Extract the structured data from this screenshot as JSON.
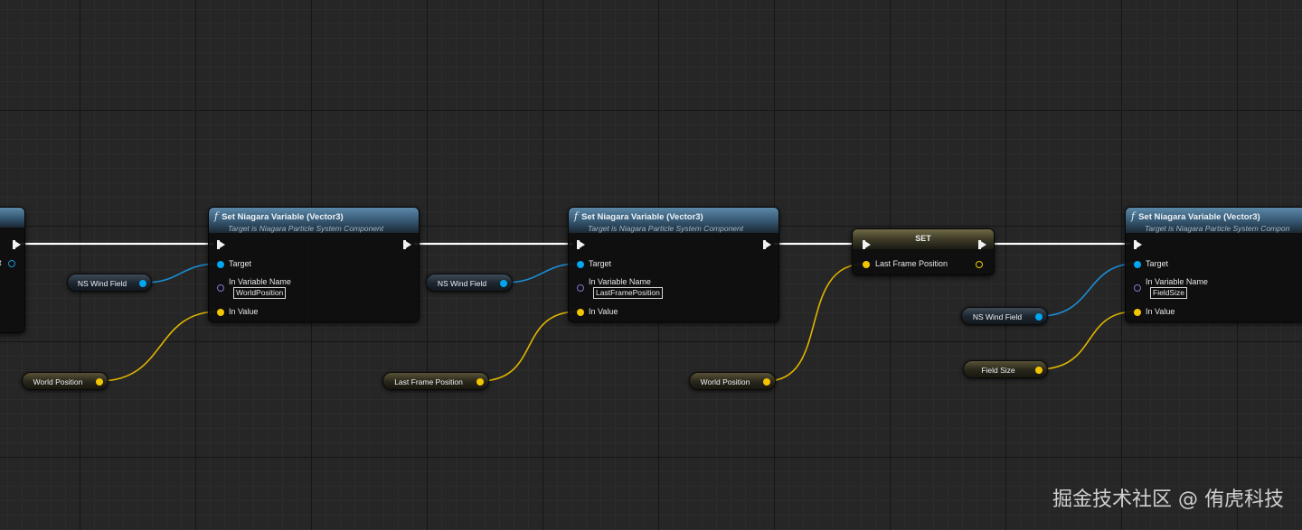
{
  "left_partial_node": {
    "pin_label": "t"
  },
  "nodes": [
    {
      "title": "Set Niagara Variable (Vector3)",
      "subtitle": "Target is Niagara Particle System Component",
      "target_label": "Target",
      "varname_label": "In Variable Name",
      "varname_value": "WorldPosition",
      "invalue_label": "In Value"
    },
    {
      "title": "Set Niagara Variable (Vector3)",
      "subtitle": "Target is Niagara Particle System Component",
      "target_label": "Target",
      "varname_label": "In Variable Name",
      "varname_value": "LastFramePosition",
      "invalue_label": "In Value"
    },
    {
      "title": "Set Niagara Variable (Vector3)",
      "subtitle": "Target is Niagara Particle System Compon",
      "target_label": "Target",
      "varname_label": "In Variable Name",
      "varname_value": "FieldSize",
      "invalue_label": "In Value"
    }
  ],
  "set_node": {
    "title": "SET",
    "pin_label": "Last Frame Position"
  },
  "variables": [
    {
      "label": "NS Wind Field",
      "type": "object"
    },
    {
      "label": "World Position",
      "type": "vector"
    },
    {
      "label": "NS Wind Field",
      "type": "object"
    },
    {
      "label": "Last Frame Position",
      "type": "vector"
    },
    {
      "label": "World Position",
      "type": "vector"
    },
    {
      "label": "NS Wind Field",
      "type": "object"
    },
    {
      "label": "Field Size",
      "type": "vector"
    }
  ],
  "colors": {
    "exec_wire": "#ffffff",
    "object_wire": "#1a8fd6",
    "vector_wire": "#e0b400",
    "name_pin": "#8d6fd0",
    "function_header": "#4a7494",
    "set_header": "#6b6542"
  },
  "watermark": "掘金技术社区 @ 侑虎科技"
}
